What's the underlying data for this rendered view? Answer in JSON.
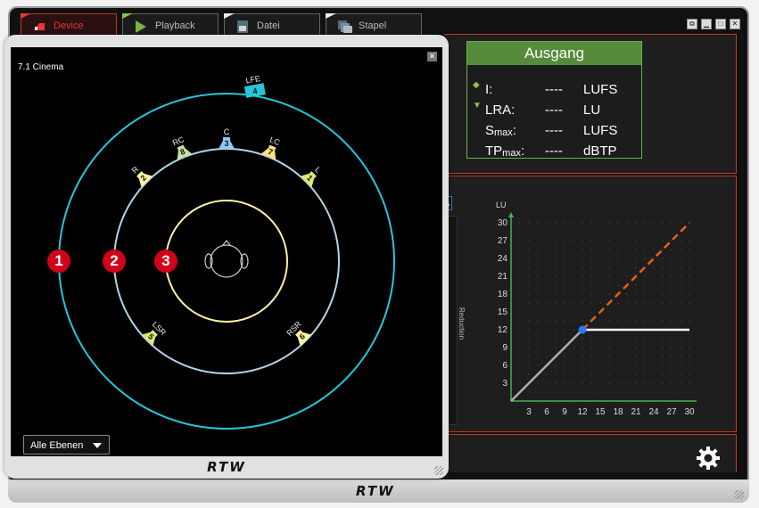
{
  "tabs": [
    {
      "label": "Device",
      "icon": "device-icon",
      "active": true
    },
    {
      "label": "Playback",
      "icon": "play-icon",
      "active": false
    },
    {
      "label": "Datei",
      "icon": "file-icon",
      "active": false
    },
    {
      "label": "Stapel",
      "icon": "stack-icon",
      "active": false
    }
  ],
  "ausgang": {
    "title": "Ausgang",
    "rows": [
      {
        "label": "I:",
        "value": "----",
        "unit": "LUFS"
      },
      {
        "label": "LRA:",
        "value": "----",
        "unit": "LU"
      },
      {
        "label": "S",
        "sub": "max",
        "suffix": ":",
        "value": "----",
        "unit": "LUFS"
      },
      {
        "label": "TP",
        "sub": "max",
        "suffix": ":",
        "value": "----",
        "unit": "dBTP"
      }
    ]
  },
  "meter": {
    "badge": "RA",
    "label": "Reduction"
  },
  "chart_data": {
    "type": "line",
    "title": "",
    "ylabel": "LU",
    "xlabel": "",
    "xlim": [
      0,
      30
    ],
    "ylim": [
      0,
      30
    ],
    "x_ticks": [
      3,
      6,
      9,
      12,
      15,
      18,
      21,
      24,
      27,
      30
    ],
    "y_ticks": [
      3,
      6,
      9,
      12,
      15,
      18,
      21,
      24,
      27,
      30
    ],
    "grid": true,
    "series": [
      {
        "points": [
          [
            0,
            0
          ],
          [
            12,
            12
          ]
        ],
        "color": "#b0b0b0",
        "style": "solid"
      },
      {
        "points": [
          [
            12,
            12
          ],
          [
            30,
            30
          ]
        ],
        "color": "#e8601c",
        "style": "dashed"
      },
      {
        "points": [
          [
            12,
            12
          ],
          [
            30,
            12
          ]
        ],
        "color": "#ffffff",
        "style": "solid"
      }
    ],
    "marker": {
      "x": 12,
      "y": 12,
      "color": "#2979ff"
    }
  },
  "popup": {
    "title": "7.1 Cinema",
    "speakers": [
      {
        "label": "LFE",
        "num": "4",
        "color": "#26c6da"
      },
      {
        "label": "C",
        "num": "3",
        "color": "#90caf9"
      },
      {
        "label": "RC",
        "num": "8",
        "color": "#c5e1a5"
      },
      {
        "label": "LC",
        "num": "7",
        "color": "#ffe082"
      },
      {
        "label": "R",
        "num": "2",
        "color": "#fff59d"
      },
      {
        "label": "L",
        "num": "1",
        "color": "#dce775"
      },
      {
        "label": "LSR",
        "num": "5",
        "color": "#dce775"
      },
      {
        "label": "RSR",
        "num": "6",
        "color": "#fff59d"
      }
    ],
    "ring_numbers": [
      "1",
      "2",
      "3"
    ],
    "layer_select": "Alle Ebenen"
  },
  "brand": "RTW",
  "colors": {
    "accent": "#c0392b",
    "green": "#558b3a",
    "cyan": "#26c6da",
    "light_blue": "#b3d4e8",
    "pale_yellow": "#fff2a8"
  }
}
